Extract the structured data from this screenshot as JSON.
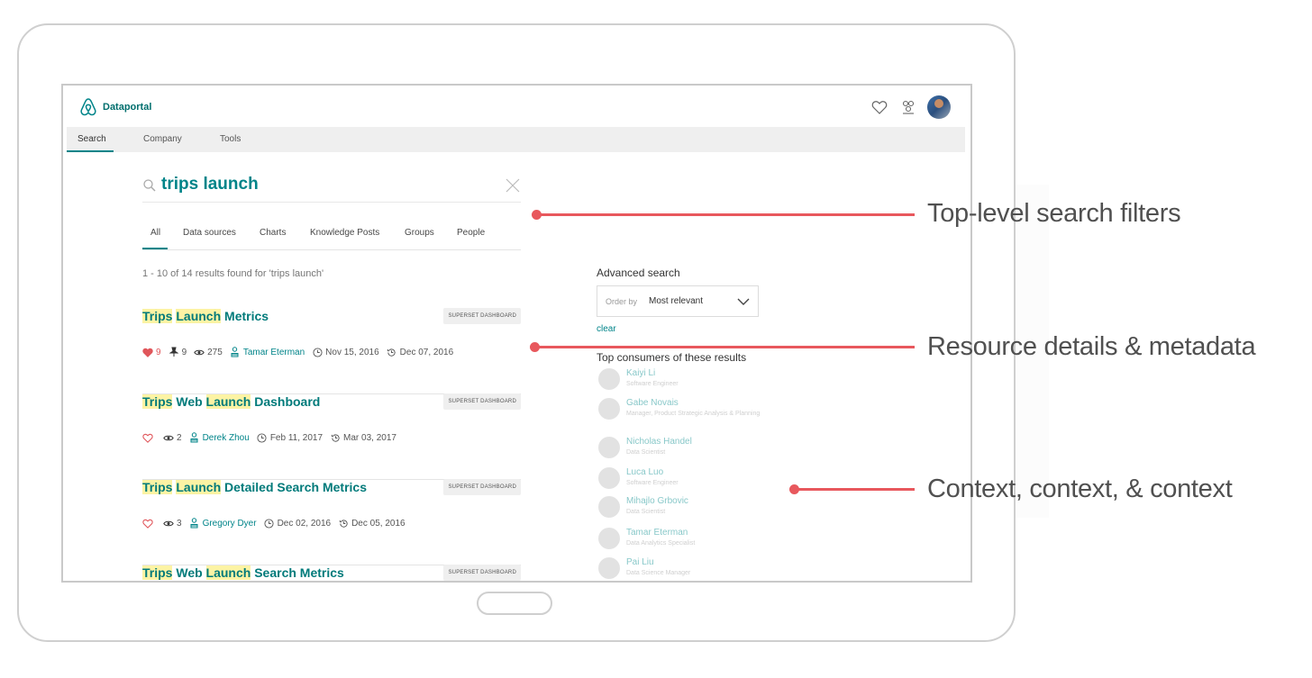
{
  "app": {
    "brand": "Dataportal"
  },
  "nav": {
    "items": [
      "Search",
      "Company",
      "Tools"
    ]
  },
  "search": {
    "query": "trips launch"
  },
  "filters": [
    "All",
    "Data sources",
    "Charts",
    "Knowledge Posts",
    "Groups",
    "People"
  ],
  "result_count": "1 - 10 of 14 results found for 'trips launch'",
  "results": [
    {
      "title_parts": [
        [
          "Trips",
          true
        ],
        [
          " ",
          false
        ],
        [
          "Launch",
          true
        ],
        [
          " Metrics",
          false
        ]
      ],
      "badge": "SUPERSET DASHBOARD",
      "likes": "9",
      "liked": true,
      "pins": "9",
      "views": "275",
      "owner": "Tamar Eterman",
      "created": "Nov 15, 2016",
      "updated": "Dec 07, 2016"
    },
    {
      "title_parts": [
        [
          "Trips",
          true
        ],
        [
          " Web ",
          false
        ],
        [
          "Launch",
          true
        ],
        [
          " Dashboard",
          false
        ]
      ],
      "badge": "SUPERSET DASHBOARD",
      "likes": "",
      "liked": false,
      "pins": "",
      "views": "2",
      "owner": "Derek Zhou",
      "created": "Feb 11, 2017",
      "updated": "Mar 03, 2017"
    },
    {
      "title_parts": [
        [
          "Trips",
          true
        ],
        [
          " ",
          false
        ],
        [
          "Launch",
          true
        ],
        [
          " Detailed Search Metrics",
          false
        ]
      ],
      "badge": "SUPERSET DASHBOARD",
      "likes": "",
      "liked": false,
      "pins": "",
      "views": "3",
      "owner": "Gregory Dyer",
      "created": "Dec 02, 2016",
      "updated": "Dec 05, 2016"
    },
    {
      "title_parts": [
        [
          "Trips",
          true
        ],
        [
          " Web ",
          false
        ],
        [
          "Launch",
          true
        ],
        [
          " Search Metrics",
          false
        ]
      ],
      "badge": "SUPERSET DASHBOARD",
      "likes": "",
      "liked": false,
      "pins": "",
      "views": "",
      "owner": "",
      "created": "",
      "updated": ""
    }
  ],
  "sidebar": {
    "advanced_title": "Advanced search",
    "order_label": "Order by",
    "order_value": "Most relevant",
    "clear": "clear",
    "consumers_title": "Top consumers of these results",
    "consumers": [
      {
        "name": "Kaiyi Li",
        "role": "Software Engineer"
      },
      {
        "name": "Gabe Novais",
        "role": "Manager, Product Strategic Analysis & Planning"
      },
      {
        "name": "Nicholas Handel",
        "role": "Data Scientist"
      },
      {
        "name": "Luca Luo",
        "role": "Software Engineer"
      },
      {
        "name": "Mihajlo Grbovic",
        "role": "Data Scientist"
      },
      {
        "name": "Tamar Eterman",
        "role": "Data Analytics Specialist"
      },
      {
        "name": "Pai Liu",
        "role": "Data Science Manager"
      }
    ]
  },
  "annotations": {
    "filters": "Top-level search filters",
    "details": "Resource details & metadata",
    "context": "Context, context, & context",
    "color": "#e8585d"
  },
  "colors": {
    "accent": "#008489",
    "highlight": "#fcf3a4"
  }
}
